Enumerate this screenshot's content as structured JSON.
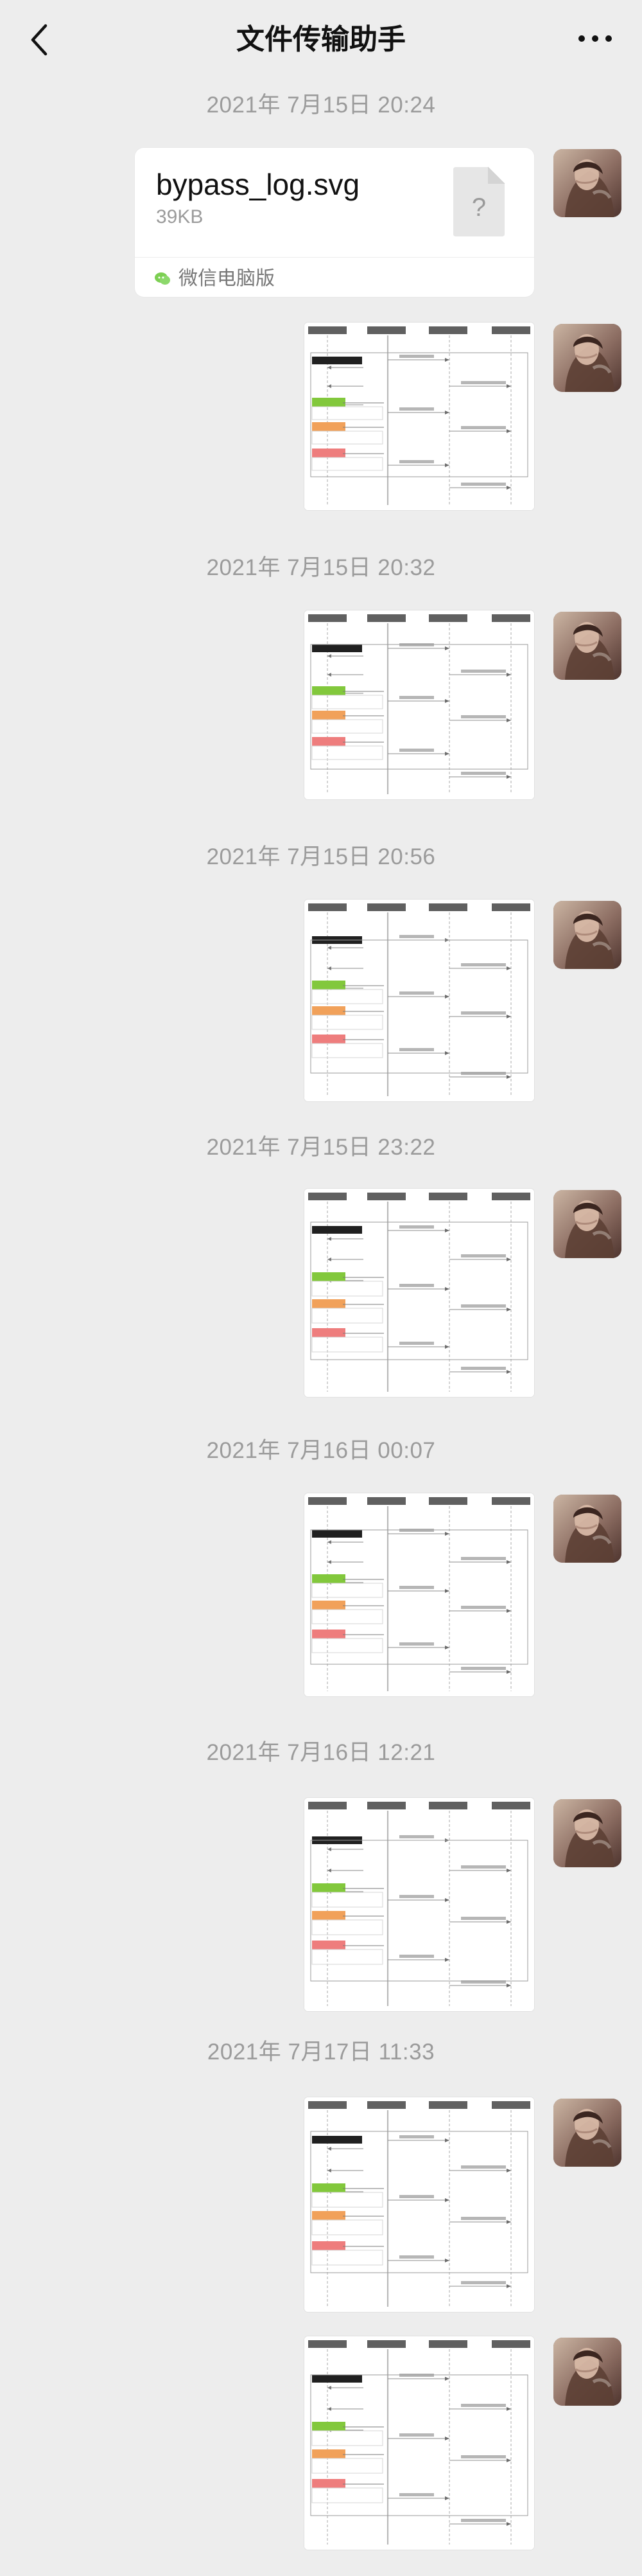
{
  "header": {
    "title": "文件传输助手",
    "back_icon": "chevron-left-icon",
    "more_icon": "more-horizontal-icon"
  },
  "messages": [
    {
      "timestamp": "2021年 7月15日 20:24",
      "file": {
        "name": "bypass_log.svg",
        "size": "39KB",
        "source": "微信电脑版",
        "icon": "file-unknown-icon"
      }
    },
    {
      "timestamp": "2021年 7月15日 20:32"
    },
    {
      "timestamp": "2021年 7月15日 20:56"
    },
    {
      "timestamp": "2021年 7月15日 23:22"
    },
    {
      "timestamp": "2021年 7月16日 00:07"
    },
    {
      "timestamp": "2021年 7月16日 12:21"
    },
    {
      "timestamp": "2021年 7月17日 11:33"
    }
  ],
  "colors": {
    "background": "#EDEDED",
    "bubble": "#FFFFFF",
    "timestamp": "#9B9B9B",
    "accent_green": "#82C83C",
    "accent_orange": "#F1A15A",
    "accent_red": "#EE7D7D",
    "dark_bar": "#202020"
  }
}
